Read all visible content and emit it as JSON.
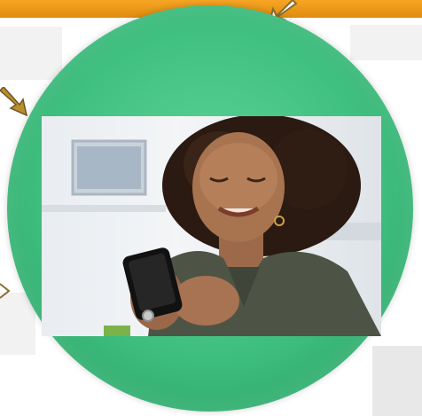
{
  "colors": {
    "accent_bar": "#f29b1a",
    "circle": "#44c486",
    "arrow": "#8a6d2f"
  },
  "icons": {
    "arrow_top": "arrow-down-left-icon",
    "arrow_left": "arrow-down-right-icon"
  },
  "image": {
    "subject": "woman-using-smartphone"
  }
}
